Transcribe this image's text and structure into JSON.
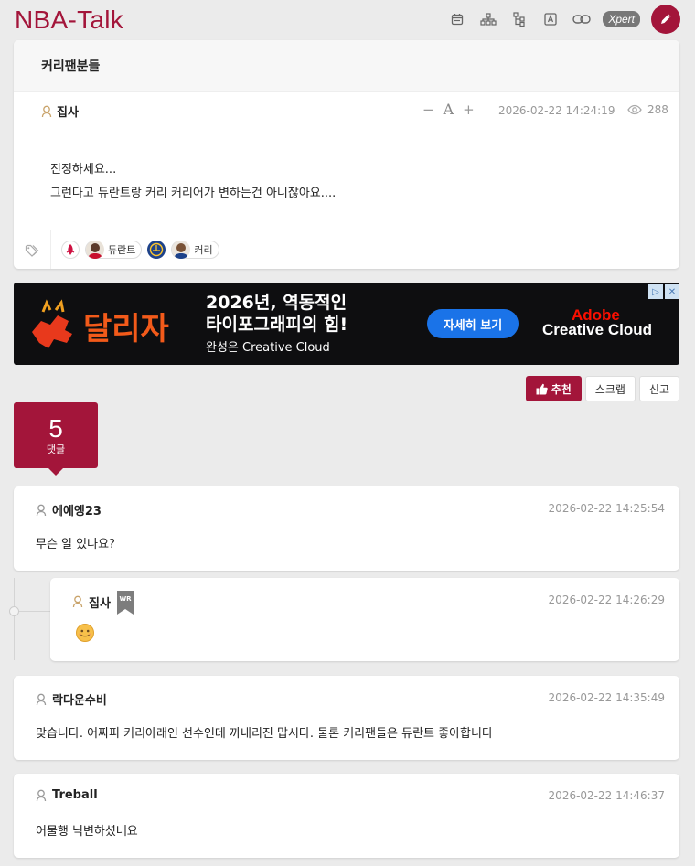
{
  "header": {
    "logo": "NBA-Talk",
    "xpert_label": "Xpert",
    "brand_color": "#a3153a",
    "icons": [
      "calendar-icon",
      "org-chart-icon",
      "tree-icon",
      "font-icon",
      "link-icon"
    ]
  },
  "post": {
    "title": "커리팬분들",
    "author": "집사",
    "font_minus": "−",
    "font_a": "A",
    "font_plus": "+",
    "date": "2026-02-22 14:24:19",
    "views": "288",
    "body_line1": "진정하세요...",
    "body_line2": "그런다고 듀란트랑 커리 커리어가 변하는건 아니잖아요....",
    "tags": [
      {
        "type": "team",
        "name": "rockets"
      },
      {
        "type": "player",
        "label": "듀란트"
      },
      {
        "type": "team",
        "name": "warriors"
      },
      {
        "type": "player",
        "label": "커리"
      }
    ]
  },
  "ad": {
    "art_text": "달리자",
    "headline_line1": "2026년, 역동적인",
    "headline_line2": "타이포그래피의 힘!",
    "subline": "완성은 Creative Cloud",
    "cta": "자세히 보기",
    "brand_top": "Adobe",
    "brand_bottom": "Creative Cloud",
    "badge1": "▷",
    "badge2": "✕"
  },
  "actions": {
    "recommend": "추천",
    "scrap": "스크랩",
    "report": "신고"
  },
  "comments_count": {
    "number": "5",
    "label": "댓글"
  },
  "comments": [
    {
      "author": "에에엥23",
      "date": "2026-02-22 14:25:54",
      "body": "무슨 일 있나요?"
    },
    {
      "author": "집사",
      "badge": "WR",
      "date": "2026-02-22 14:26:29",
      "body": "",
      "emoji": "smile-emoji",
      "reply": true
    },
    {
      "author": "락다운수비",
      "date": "2026-02-22 14:35:49",
      "body": "맞습니다. 어짜피 커리아래인 선수인데 까내리진 맙시다. 물론 커리팬들은 듀란트 좋아합니다"
    },
    {
      "author": "Treball",
      "date": "2026-02-22 14:46:37",
      "body": "어물행 닉변하셨네요"
    }
  ]
}
